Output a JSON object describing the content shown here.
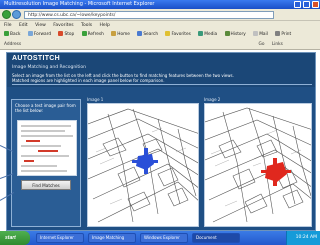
{
  "window": {
    "title": "Multiresolution Image Matching - Microsoft Internet Explorer"
  },
  "address": {
    "url": "http://www.cs.ubc.ca/~lowe/keypoints/"
  },
  "menu": {
    "items": [
      "File",
      "Edit",
      "View",
      "Favorites",
      "Tools",
      "Help"
    ]
  },
  "toolbar": {
    "items": [
      "Back",
      "Forward",
      "Stop",
      "Refresh",
      "Home",
      "Search",
      "Favorites",
      "Media",
      "History",
      "Mail",
      "Print"
    ]
  },
  "links": {
    "label": "Links",
    "items": [
      "Address",
      "Go"
    ]
  },
  "page": {
    "title": "AUTOSTITCH",
    "subtitle": "Image Matching and Recognition",
    "intro_lines": [
      "Select an image from the list on the left and click the button to find matching features between the two views.",
      "Matched regions are highlighted in each image panel below for comparison."
    ],
    "left_panel_text": "Choose a test image pair from the list below:",
    "left_button": "Find Matches",
    "left_map_label": "Image 1",
    "right_map_label": "Image 2"
  },
  "taskbar": {
    "start_label": "start",
    "tasks": [
      "Internet Explorer",
      "Image Matching",
      "Windows Explorer",
      "Document"
    ],
    "clock": "10:24 AM"
  },
  "colors": {
    "page_bg": "#1f4f84",
    "marker_left": "#2a4fd8",
    "marker_right": "#e0281e"
  }
}
